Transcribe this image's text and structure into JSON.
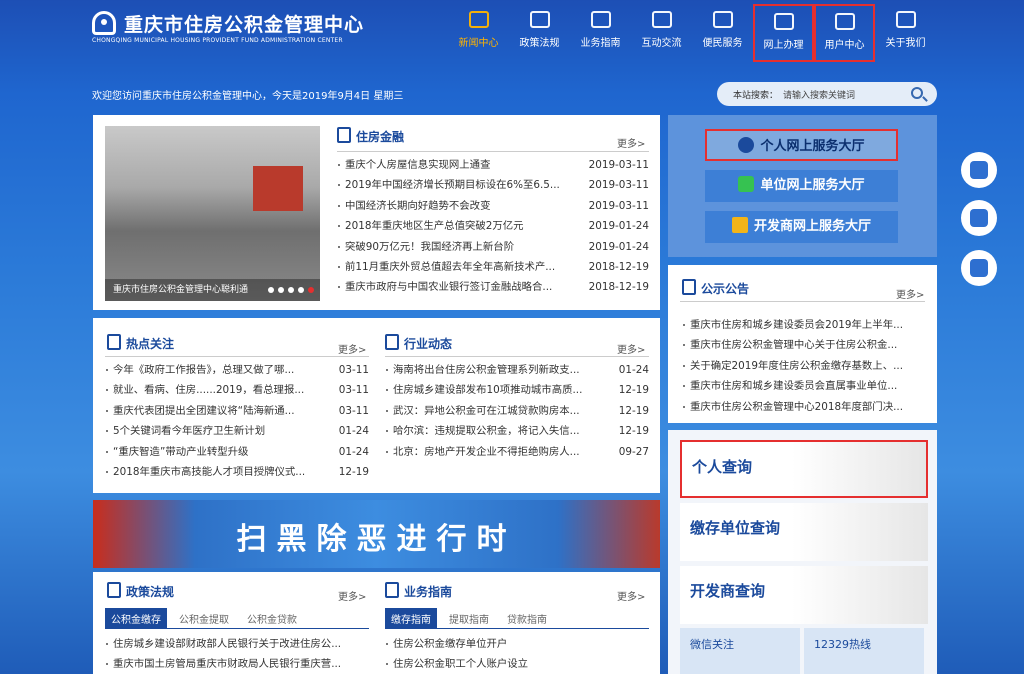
{
  "header": {
    "title_cn": "重庆市住房公积金管理中心",
    "title_en": "CHONGQING MUNICIPAL HOUSING PROVIDENT FUND ADMINISTRATION CENTER"
  },
  "nav": [
    {
      "label": "新闻中心",
      "icon": "newspaper-icon"
    },
    {
      "label": "政策法规",
      "icon": "book-icon"
    },
    {
      "label": "业务指南",
      "icon": "document-icon"
    },
    {
      "label": "互动交流",
      "icon": "chat-icon"
    },
    {
      "label": "便民服务",
      "icon": "service-icon"
    },
    {
      "label": "网上办理",
      "icon": "monitor-icon"
    },
    {
      "label": "用户中心",
      "icon": "user-headset-icon"
    },
    {
      "label": "关于我们",
      "icon": "list-icon"
    }
  ],
  "welcome": "欢迎您访问重庆市住房公积金管理中心，今天是2019年9月4日 星期三",
  "search": {
    "label": "本站搜索：",
    "placeholder": "请输入搜索关键词"
  },
  "finance": {
    "title": "住房金融",
    "more": "更多>",
    "photo_caption": "重庆市住房公积金管理中心聪利通",
    "items": [
      {
        "t": "重庆个人房屋信息实现网上通查",
        "d": "2019-03-11"
      },
      {
        "t": "2019年中国经济增长预期目标设在6%至6.5...",
        "d": "2019-03-11"
      },
      {
        "t": "中国经济长期向好趋势不会改变",
        "d": "2019-03-11"
      },
      {
        "t": "2018年重庆地区生产总值突破2万亿元",
        "d": "2019-01-24"
      },
      {
        "t": "突破90万亿元！我国经济再上新台阶",
        "d": "2019-01-24"
      },
      {
        "t": "前11月重庆外贸总值超去年全年高新技术产...",
        "d": "2018-12-19"
      },
      {
        "t": "重庆市政府与中国农业银行签订金融战略合...",
        "d": "2018-12-19"
      }
    ]
  },
  "hot": {
    "title": "热点关注",
    "more": "更多>",
    "items": [
      {
        "t": "今年《政府工作报告》，总理又做了哪...",
        "d": "03-11"
      },
      {
        "t": "就业、看病、住房......2019，看总理报...",
        "d": "03-11"
      },
      {
        "t": "重庆代表团提出全团建议将“陆海新通...",
        "d": "03-11"
      },
      {
        "t": "5个关键词看今年医疗卫生新计划",
        "d": "01-24"
      },
      {
        "t": "“重庆智造”带动产业转型升级",
        "d": "01-24"
      },
      {
        "t": "2018年重庆市高技能人才项目授牌仪式...",
        "d": "12-19"
      }
    ]
  },
  "industry": {
    "title": "行业动态",
    "more": "更多>",
    "items": [
      {
        "t": "海南将出台住房公积金管理系列新政支...",
        "d": "01-24"
      },
      {
        "t": "住房城乡建设部发布10项推动城市高质...",
        "d": "12-19"
      },
      {
        "t": "武汉：异地公积金可在江城贷款购房本...",
        "d": "12-19"
      },
      {
        "t": "哈尔滨：违规提取公积金，将记入失信...",
        "d": "12-19"
      },
      {
        "t": "北京：房地产开发企业不得拒绝购房人...",
        "d": "09-27"
      }
    ]
  },
  "banner": {
    "text": "扫黑除恶进行时"
  },
  "policy": {
    "title": "政策法规",
    "more": "更多>",
    "tabs": [
      "公积金缴存",
      "公积金提取",
      "公积金贷款"
    ],
    "items": [
      "住房城乡建设部财政部人民银行关于改进住房公...",
      "重庆市国土房管局重庆市财政局人民银行重庆营..."
    ]
  },
  "guide": {
    "title": "业务指南",
    "more": "更多>",
    "tabs": [
      "缴存指南",
      "提取指南",
      "贷款指南"
    ],
    "items": [
      "住房公积金缴存单位开户",
      "住房公积金职工个人账户设立"
    ]
  },
  "services": [
    {
      "label": "个人网上服务大厅",
      "icon": "person-icon"
    },
    {
      "label": "单位网上服务大厅",
      "icon": "building-icon"
    },
    {
      "label": "开发商网上服务大厅",
      "icon": "developer-icon"
    }
  ],
  "notice": {
    "title": "公示公告",
    "more": "更多>",
    "items": [
      "重庆市住房和城乡建设委员会2019年上半年...",
      "重庆市住房公积金管理中心关于住房公积金...",
      "关于确定2019年度住房公积金缴存基数上、...",
      "重庆市住房和城乡建设委员会直属事业单位...",
      "重庆市住房公积金管理中心2018年度部门决..."
    ]
  },
  "queries": [
    "个人查询",
    "缴存单位查询",
    "开发商查询"
  ],
  "bottom_links": [
    "微信关注",
    "12329热线"
  ]
}
